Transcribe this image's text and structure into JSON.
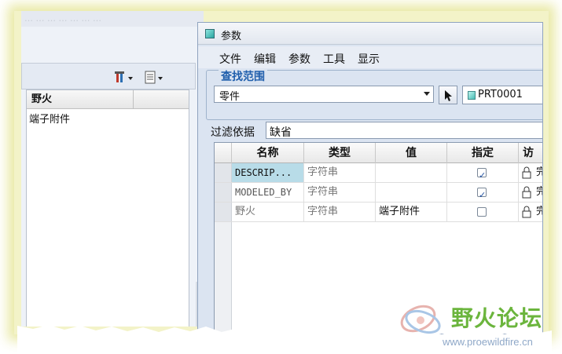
{
  "background_app": {
    "title": "…  …  …  …  …  …  …",
    "column_header": "野火",
    "cell_value": "端子附件"
  },
  "dialog": {
    "title": "参数",
    "menu": [
      "文件",
      "编辑",
      "参数",
      "工具",
      "显示"
    ],
    "scope_label": "查找范围",
    "type_value": "零件",
    "model_value": "PRT0001",
    "filter_label": "过滤依据",
    "filter_value": "缺省",
    "columns": [
      "名称",
      "类型",
      "值",
      "指定",
      "访"
    ],
    "rows": [
      {
        "name": "DESCRIP...",
        "type": "字符串",
        "value": "",
        "designate": true,
        "access": "完"
      },
      {
        "name": "MODELED_BY",
        "type": "字符串",
        "value": "",
        "designate": true,
        "access": "完"
      },
      {
        "name": "野火",
        "type": "字符串",
        "value": "端子附件",
        "designate": false,
        "access": "完"
      }
    ]
  },
  "watermark": {
    "name": "野火论坛",
    "url": "www.proewildfire.cn"
  },
  "colors": {
    "accent_blue": "#1f5eac",
    "selection": "#b8dce8",
    "watermark_green": "#6bb53d"
  }
}
